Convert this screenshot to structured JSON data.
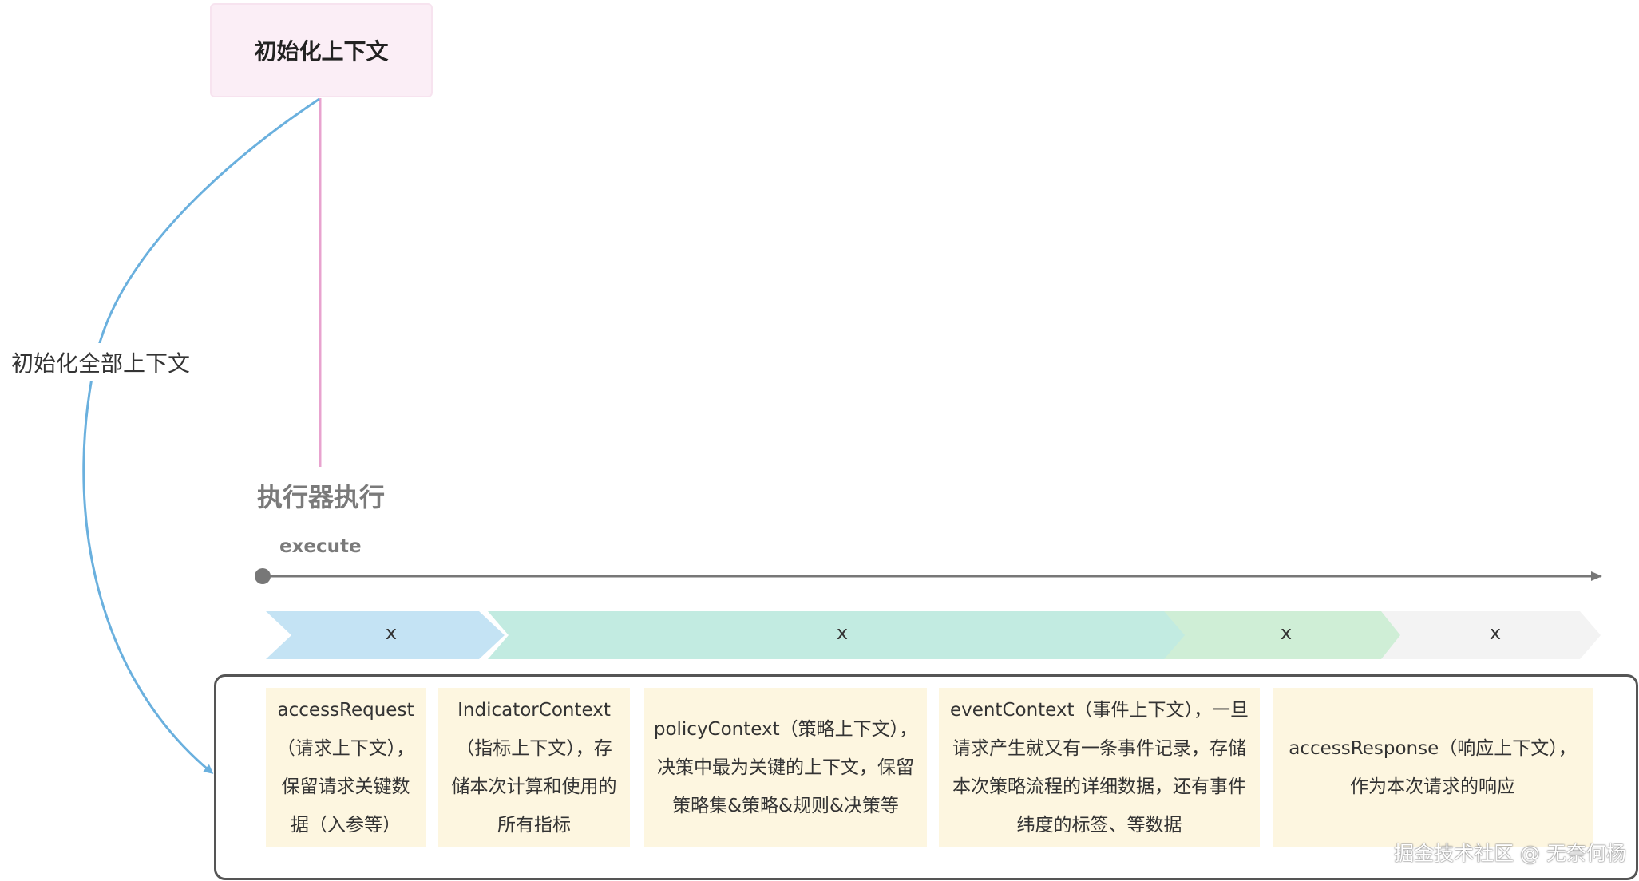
{
  "diagram": {
    "init_context": "初始化上下文",
    "init_all_context": "初始化全部上下文",
    "executor": "执行器执行",
    "execute": "execute",
    "lanes": [
      "x",
      "x",
      "x",
      "x"
    ],
    "cards": [
      {
        "lines": [
          "accessRequest",
          "（请求上下文），",
          "保留请求关键数",
          "据（入参等）"
        ]
      },
      {
        "lines": [
          "IndicatorContext",
          "（指标上下文），存",
          "储本次计算和使用的",
          "所有指标"
        ]
      },
      {
        "lines": [
          "policyContext（策略上下文），",
          "决策中最为关键的上下文，保留",
          "策略集&策略&规则&决策等"
        ]
      },
      {
        "lines": [
          "eventContext（事件上下文），一旦",
          "请求产生就又有一条事件记录，存储",
          "本次策略流程的详细数据，还有事件",
          "纬度的标签、等数据"
        ]
      },
      {
        "lines": [
          "accessResponse（响应上下文），",
          "作为本次请求的响应"
        ]
      }
    ],
    "watermark": "掘金技术社区 @ 无奈何杨"
  },
  "colors": {
    "init_box_bg": "#fbeef6",
    "pink_line": "#e8a3cf",
    "blue_arrow": "#6ab0de",
    "timeline": "#777777",
    "lane_blue": "#c4e3f4",
    "lane_teal": "#c2ebe1",
    "lane_green": "#cfeed6",
    "lane_grey": "#f3f3f3",
    "card_bg": "#fdf6e0"
  }
}
